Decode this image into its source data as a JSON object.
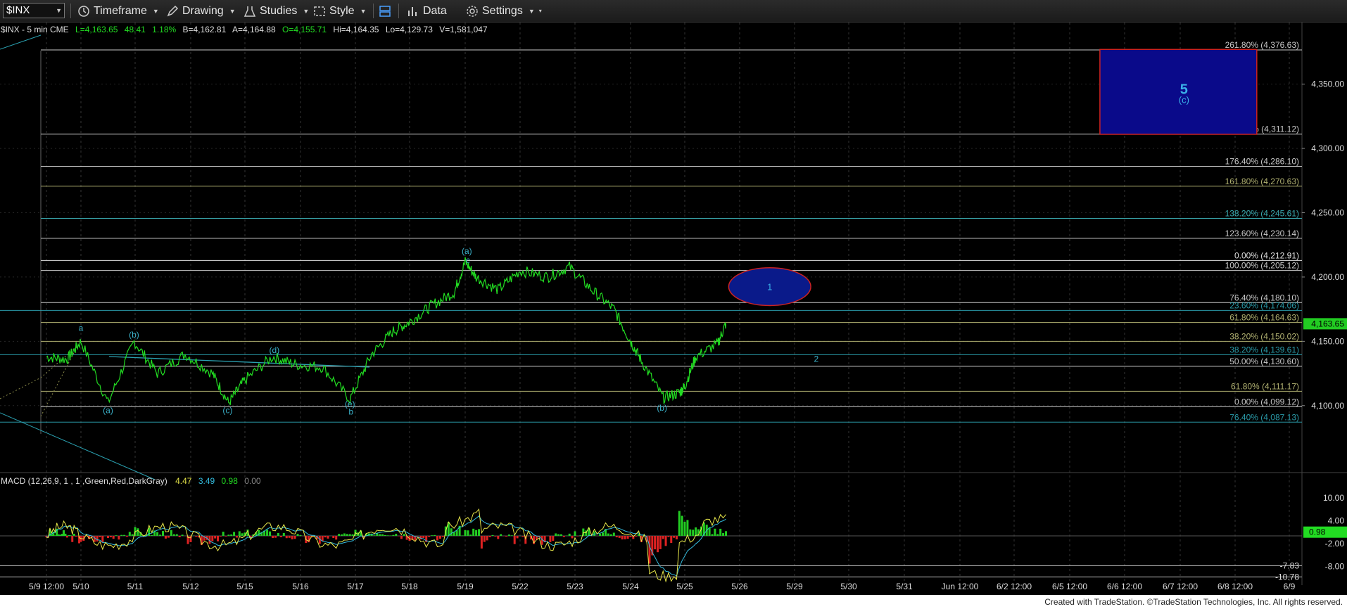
{
  "toolbar": {
    "symbol": "$INX",
    "timeframe_label": "Timeframe",
    "drawing_label": "Drawing",
    "studies_label": "Studies",
    "style_label": "Style",
    "data_label": "Data",
    "settings_label": "Settings"
  },
  "header": {
    "symbol_line": "$INX - 5 min  CME",
    "last": "L=4,163.65",
    "change": "48.41",
    "pct": "1.18%",
    "bid": "B=4,162.81",
    "ask": "A=4,164.88",
    "open": "O=4,155.71",
    "high": "Hi=4,164.35",
    "low": "Lo=4,129.73",
    "volume": "V=1,581,047"
  },
  "macd": {
    "label": "MACD (12,26,9, 1 , 1 ,Green,Red,DarkGray)",
    "v1": "4.47",
    "v2": "3.49",
    "v3": "0.98",
    "v4": "0.00",
    "current_badge": "0.98",
    "axis": [
      {
        "v": 10,
        "t": "10.00"
      },
      {
        "v": 4,
        "t": "4.00"
      },
      {
        "v": -2,
        "t": "-2.00"
      },
      {
        "v": -8,
        "t": "-8.00"
      }
    ],
    "extremes": [
      {
        "v": -7.83,
        "t": "-7.83"
      },
      {
        "v": -10.78,
        "t": "-10.78"
      }
    ]
  },
  "footer": {
    "credit": "Created with TradeStation. ©TradeStation Technologies, Inc. All rights reserved."
  },
  "chart_data": {
    "type": "line",
    "price_axis": {
      "ticks": [
        {
          "v": 4350,
          "t": "4,350.00"
        },
        {
          "v": 4300,
          "t": "4,300.00"
        },
        {
          "v": 4250,
          "t": "4,250.00"
        },
        {
          "v": 4200,
          "t": "4,200.00"
        },
        {
          "v": 4150,
          "t": "4,150.00"
        },
        {
          "v": 4100,
          "t": "4,100.00"
        }
      ],
      "ylim": [
        4078,
        4387
      ]
    },
    "current_price": {
      "v": 4163.65,
      "t": "4,163.65",
      "color": "#22cc22"
    },
    "date_axis": [
      "5/9 12:00",
      "5/10",
      "5/11",
      "5/12",
      "5/15",
      "5/16",
      "5/17",
      "5/18",
      "5/19",
      "5/22",
      "5/23",
      "5/24",
      "5/25",
      "5/26",
      "5/29",
      "5/30",
      "5/31",
      "Jun 12:00",
      "6/2 12:00",
      "6/5 12:00",
      "6/6 12:00",
      "6/7 12:00",
      "6/8 12:00",
      "6/9"
    ],
    "fib_levels": [
      {
        "label": "261.80% (4,376.63)",
        "v": 4376.63,
        "color": "#c8c8c8"
      },
      {
        "label": "200.00% (4,311.12)",
        "v": 4311.12,
        "color": "#c8c8c8"
      },
      {
        "label": "176.40% (4,286.10)",
        "v": 4286.1,
        "color": "#c8c8c8"
      },
      {
        "label": "161.80% (4,270.63)",
        "v": 4270.63,
        "color": "#b0b070"
      },
      {
        "label": "138.20% (4,245.61)",
        "v": 4245.61,
        "color": "#3aaab0"
      },
      {
        "label": "123.60% (4,230.14)",
        "v": 4230.14,
        "color": "#c8c8c8"
      },
      {
        "label": "0.00% (4,212.91)",
        "v": 4212.91,
        "color": "#e0e0e0"
      },
      {
        "label": "100.00% (4,205.12)",
        "v": 4205.12,
        "color": "#c8c8c8"
      },
      {
        "label": "76.40% (4,180.10)",
        "v": 4180.1,
        "color": "#c8c8c8"
      },
      {
        "label": "23.60% (4,174.06)",
        "v": 4174.06,
        "color": "#2a9aa8"
      },
      {
        "label": "61.80% (4,164.63)",
        "v": 4164.63,
        "color": "#b0b070"
      },
      {
        "label": "38.20% (4,150.02)",
        "v": 4150.02,
        "color": "#b0b070"
      },
      {
        "label": "38.20% (4,139.61)",
        "v": 4139.61,
        "color": "#2a9aa8"
      },
      {
        "label": "50.00% (4,130.60)",
        "v": 4130.6,
        "color": "#c8c8c8"
      },
      {
        "label": "61.80% (4,111.17)",
        "v": 4111.17,
        "color": "#b0b070"
      },
      {
        "label": "0.00% (4,099.12)",
        "v": 4099.12,
        "color": "#c8c8c8"
      },
      {
        "label": "76.40% (4,087.13)",
        "v": 4087.13,
        "color": "#2a9aa8"
      }
    ],
    "wave_labels": [
      {
        "t": "a",
        "x": 1,
        "v": 4158,
        "color": "#3ab0c8"
      },
      {
        "t": "(b)",
        "x": 1.98,
        "v": 4153,
        "color": "#3ab0c8"
      },
      {
        "t": "(a)",
        "x": 1.5,
        "v": 4094,
        "color": "#3ab0c8"
      },
      {
        "t": "(c)",
        "x": 3.68,
        "v": 4094,
        "color": "#3ab0c8"
      },
      {
        "t": "(d)",
        "x": 4.53,
        "v": 4141,
        "color": "#3ab0c8"
      },
      {
        "t": "(e)",
        "x": 5.9,
        "v": 4099,
        "color": "#3ab0c8"
      },
      {
        "t": "b",
        "x": 5.92,
        "v": 4093,
        "color": "#3ab0c8"
      },
      {
        "t": "(a)",
        "x": 8.03,
        "v": 4218,
        "color": "#3ab0c8"
      },
      {
        "t": "c",
        "x": 8.05,
        "v": 4211,
        "color": "#3ab0c8"
      },
      {
        "t": "(b)",
        "x": 11.58,
        "v": 4096,
        "color": "#3ab0c8"
      },
      {
        "t": "2",
        "x": 14.4,
        "v": 4134,
        "color": "#3ab0c8"
      }
    ],
    "target_zones": [
      {
        "label": "5",
        "sub": "(c)",
        "x0": 19.55,
        "x1": 22.4,
        "v0": 4377,
        "v1": 4311,
        "fill": "#0a0a8a",
        "stroke": "#cc2222"
      },
      {
        "label": "1",
        "x0": 12.8,
        "x1": 14.3,
        "v0": 4205,
        "v1": 4180,
        "fill": "#0a1a8a",
        "stroke": "#cc2222",
        "shape": "ellipse"
      }
    ]
  }
}
